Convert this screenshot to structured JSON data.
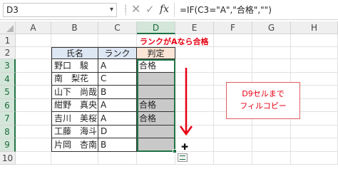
{
  "formula_bar": {
    "name_box": "D3",
    "name_box_chevron": "▾",
    "more_dots": "⋮",
    "cancel_glyph": "✕",
    "enter_glyph": "✓",
    "fx_label": "fx",
    "formula": "=IF(C3=\"A\",\"合格\",\"\")"
  },
  "columns": [
    "A",
    "B",
    "C",
    "D",
    "E",
    "F",
    "G",
    "H"
  ],
  "active_column": "D",
  "rows": [
    "1",
    "2",
    "3",
    "4",
    "5",
    "6",
    "7",
    "8",
    "9",
    "10"
  ],
  "active_rows": [
    "3",
    "4",
    "5",
    "6",
    "7",
    "8",
    "9"
  ],
  "table": {
    "headers": [
      "氏名",
      "ランク",
      "判定"
    ],
    "rows": [
      {
        "name": "野口　駿",
        "rank": "A",
        "result": "合格",
        "shaded": false
      },
      {
        "name": "南　梨花",
        "rank": "C",
        "result": "",
        "shaded": true
      },
      {
        "name": "山下　尚哉",
        "rank": "B",
        "result": "",
        "shaded": true
      },
      {
        "name": "紺野　真央",
        "rank": "A",
        "result": "合格",
        "shaded": true
      },
      {
        "name": "吉川　美桜",
        "rank": "A",
        "result": "合格",
        "shaded": true
      },
      {
        "name": "工藤　海斗",
        "rank": "D",
        "result": "",
        "shaded": true
      },
      {
        "name": "片岡　杏南",
        "rank": "B",
        "result": "",
        "shaded": true
      }
    ]
  },
  "annotations": {
    "red_label": "ランクがAなら合格",
    "callout_line1": "D9セルまで",
    "callout_line2": "フィルコピー",
    "plus_cursor": "✚"
  },
  "colors": {
    "accent_green": "#217346",
    "annotation_red": "#e60012",
    "header_blue": "#dde6f3",
    "header_orange": "#fbe5d6",
    "fill_gray": "#c9c9c9"
  }
}
